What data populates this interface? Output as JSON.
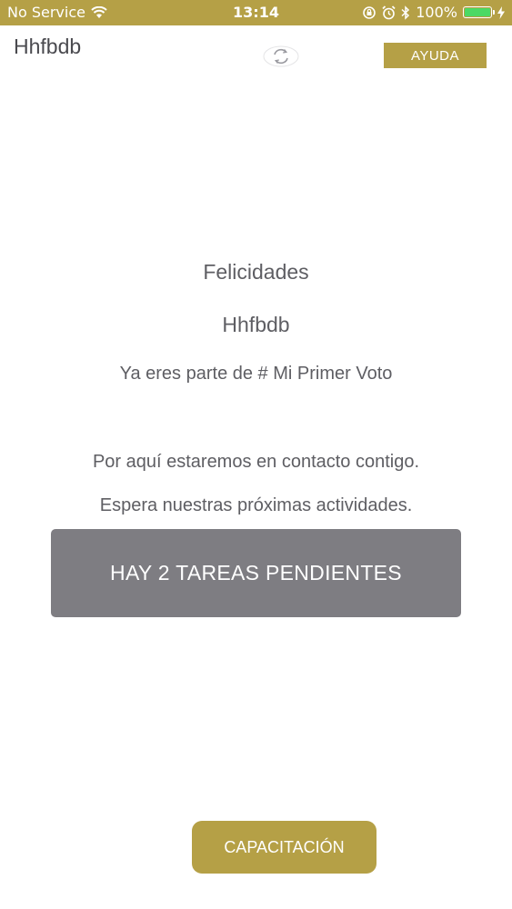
{
  "status_bar": {
    "carrier": "No Service",
    "time": "13:14",
    "battery_percent": "100%",
    "battery_level": 1.0,
    "battery_color": "#4cd964",
    "icons": [
      "wifi-icon",
      "orientation-lock-icon",
      "alarm-icon",
      "bluetooth-icon",
      "battery-icon",
      "charging-bolt-icon"
    ]
  },
  "header": {
    "title": "Hhfbdb",
    "refresh_icon": "refresh-icon",
    "help_label": "AYUDA"
  },
  "main": {
    "congrats": "Felicidades",
    "user_name": "Hhfbdb",
    "membership": "Ya eres parte de # Mi Primer Voto",
    "contact": "Por aquí estaremos en contacto contigo.",
    "wait": "Espera nuestras próximas actividades.",
    "tasks_label": "HAY 2 TAREAS PENDIENTES"
  },
  "footer": {
    "training_label": "CAPACITACIÓN"
  },
  "colors": {
    "accent": "#b5a046",
    "tasks_bg": "#7e7d82",
    "text": "#5e5e63"
  }
}
